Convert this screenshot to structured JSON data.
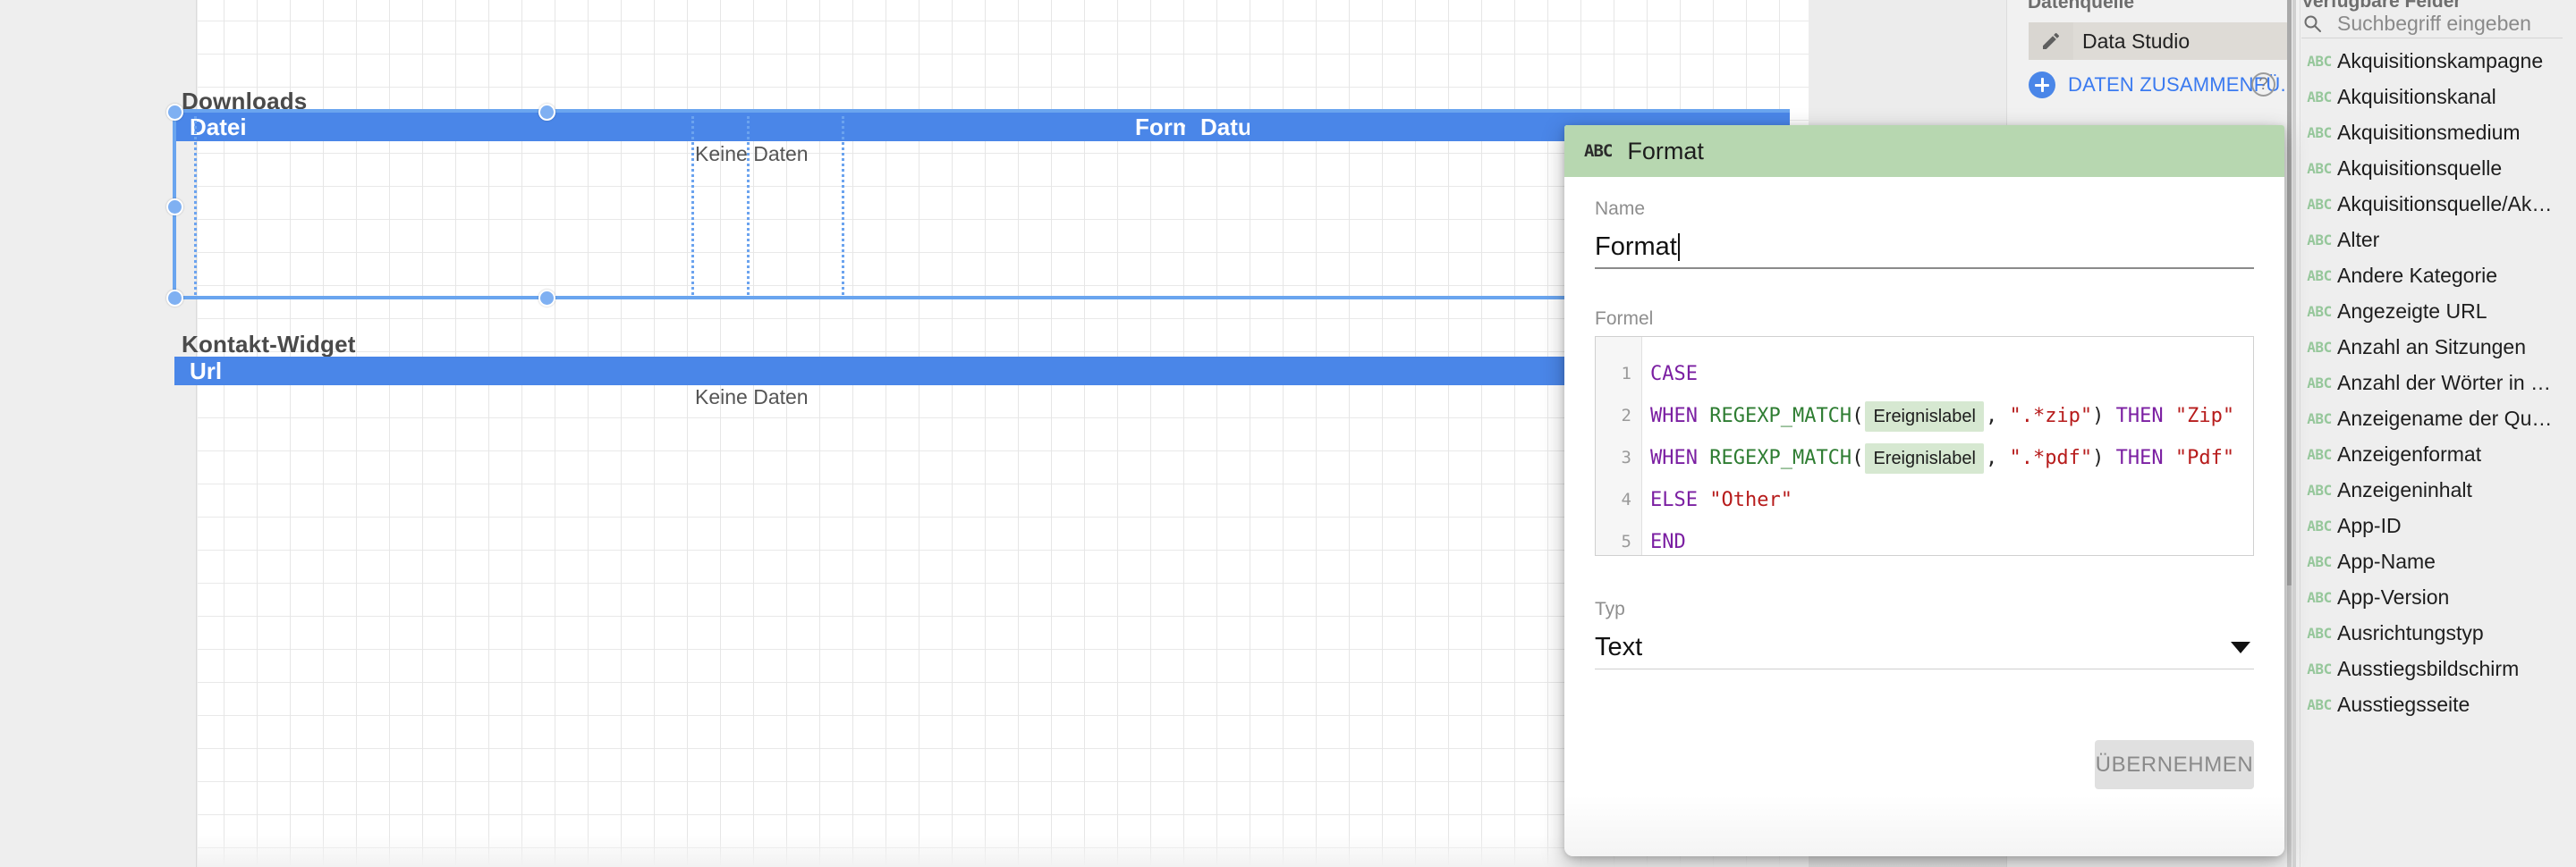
{
  "canvas": {
    "widgets": [
      {
        "title": "Downloads",
        "columns": [
          "Datei",
          "Format",
          "Datum"
        ],
        "empty_text": "Keine Daten",
        "selected": true
      },
      {
        "title": "Kontakt-Widget",
        "columns": [
          "Url"
        ],
        "empty_text": "Keine Daten",
        "selected": false
      }
    ]
  },
  "data_source_panel": {
    "title": "Datenquelle",
    "source_name": "Data Studio",
    "edit_icon": "pencil-icon",
    "merge_label": "DATEN ZUSAMMENFÜ...",
    "add_icon": "plus-circle-icon",
    "help_icon": "question-mark-icon"
  },
  "fields_panel": {
    "title": "Verfügbare Felder",
    "search": {
      "placeholder": "Suchbegriff eingeben",
      "value": "",
      "icon": "search-icon"
    },
    "type_icon": "abc-text-type-icon",
    "fields": [
      "Akquisitionskampagne",
      "Akquisitionskanal",
      "Akquisitionsmedium",
      "Akquisitionsquelle",
      "Akquisitionsquelle/Ak…",
      "Alter",
      "Andere Kategorie",
      "Angezeigte URL",
      "Anzahl an Sitzungen",
      "Anzahl der Wörter in d…",
      "Anzeigename der Que…",
      "Anzeigenformat",
      "Anzeigeninhalt",
      "App-ID",
      "App-Name",
      "App-Version",
      "Ausrichtungstyp",
      "Ausstiegsbildschirm",
      "Ausstiegsseite"
    ]
  },
  "dialog": {
    "header": {
      "type_icon": "abc-text-type-icon",
      "title": "Format"
    },
    "name": {
      "label": "Name",
      "value": "Format"
    },
    "formula": {
      "label": "Formel",
      "lines": [
        {
          "number": "1",
          "tokens": [
            {
              "t": "kw",
              "v": "CASE"
            }
          ]
        },
        {
          "number": "2",
          "tokens": [
            {
              "t": "kw",
              "v": "WHEN "
            },
            {
              "t": "fn",
              "v": "REGEXP_MATCH"
            },
            {
              "t": "pn",
              "v": "("
            },
            {
              "t": "chip",
              "v": "Ereignislabel"
            },
            {
              "t": "pn",
              "v": ", "
            },
            {
              "t": "str",
              "v": "\".*zip\""
            },
            {
              "t": "pn",
              "v": ") "
            },
            {
              "t": "kw",
              "v": "THEN "
            },
            {
              "t": "str",
              "v": "\"Zip\""
            }
          ]
        },
        {
          "number": "3",
          "tokens": [
            {
              "t": "kw",
              "v": "WHEN "
            },
            {
              "t": "fn",
              "v": "REGEXP_MATCH"
            },
            {
              "t": "pn",
              "v": "("
            },
            {
              "t": "chip",
              "v": "Ereignislabel"
            },
            {
              "t": "pn",
              "v": ", "
            },
            {
              "t": "str",
              "v": "\".*pdf\""
            },
            {
              "t": "pn",
              "v": ") "
            },
            {
              "t": "kw",
              "v": "THEN "
            },
            {
              "t": "str",
              "v": "\"Pdf\""
            }
          ]
        },
        {
          "number": "4",
          "tokens": [
            {
              "t": "kw",
              "v": "ELSE "
            },
            {
              "t": "str",
              "v": "\"Other\""
            }
          ]
        },
        {
          "number": "5",
          "tokens": [
            {
              "t": "kw",
              "v": "END"
            }
          ]
        }
      ]
    },
    "type": {
      "label": "Typ",
      "value": "Text",
      "chevron_icon": "chevron-down-icon"
    },
    "apply_label": "ÜBERNEHMEN"
  },
  "colors": {
    "accent_blue": "#4a86e8",
    "header_green": "#b7d7b0",
    "chip_green": "#d6e8d1",
    "link_blue": "#3a7af0",
    "abc_green": "#96c79b"
  }
}
